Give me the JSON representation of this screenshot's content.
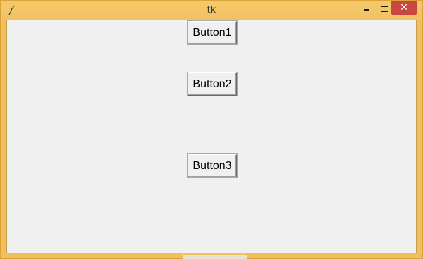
{
  "window": {
    "title": "tk",
    "app_icon": "feather-icon",
    "controls": {
      "minimize_icon": "minimize-icon",
      "maximize_icon": "maximize-icon",
      "close_icon": "close-icon",
      "close_glyph": "✕"
    },
    "colors": {
      "frame": "#f0c060",
      "client": "#f0f0f0",
      "close": "#c9473f"
    }
  },
  "buttons": [
    {
      "label": "Button1"
    },
    {
      "label": "Button2"
    },
    {
      "label": "Button3"
    }
  ]
}
